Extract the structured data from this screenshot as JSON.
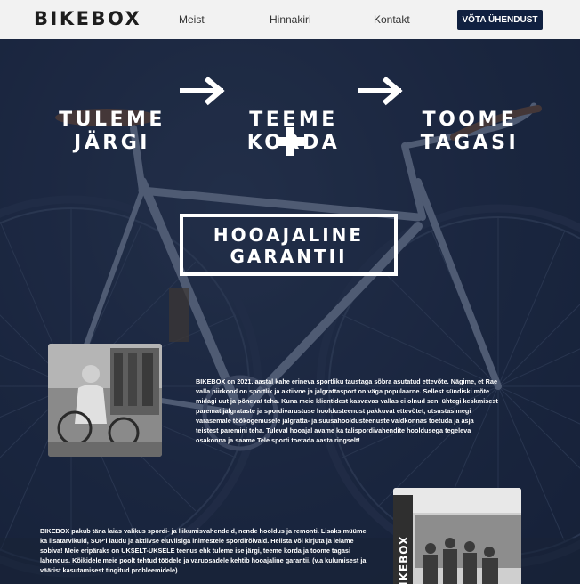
{
  "navbar": {
    "logo": "BIKEBOX",
    "links": [
      "Meist",
      "Hinnakiri",
      "Kontakt"
    ],
    "cta_label": "VÕTA ÜHENDUST"
  },
  "hero": {
    "step1": "TULEME\nJÄRGI",
    "step2": "TEEME\nKORDA",
    "step3": "TOOME\nTAGASI",
    "warranty": "HOOAJALINE\nGARANTII",
    "about_text": "BIKEBOX on 2021. aastal kahe erineva sportliku taustaga sõbra asutatud ettevõte. Nägime, et Rae valla piirkond on sportlik ja aktiivne ja jalgrattasport on väga populaarne. Sellest sündiski mõte midagi uut ja põnevat teha. Kuna meie klientidest kasvavas vallas ei olnud seni ühtegi keskmisest paremat jalgrataste ja spordivarustuse hooldusteenust pakkuvat ettevõtet, otsustasimegi varasemale töökogemusele jalgratta- ja suusahooldusteenuste valdkonnas toetuda ja asja teistest paremini teha. Tuleval hooajal avame ka talispordivahendite hooldusega tegeleva osakonna ja saame Tele sporti toetada aasta ringselt!",
    "services_text": "BIKEBOX pakub täna laias valikus spordi- ja liikumisvahendeid, nende hooldus ja remonti. Lisaks müüme ka lisatarvikuid, SUP'i laudu ja aktiivse eluviisiga inimestele spordirõivaid. Helista või kirjuta ja leiame sobiva! Meie eripäraks on UKSELT-UKSELE teenus ehk tuleme ise järgi, teeme korda ja toome tagasi lahendus. Kõikidele meie poolt tehtud töödele ja varuosadele kehtib hooajaline garantii. (v.a kulumisest ja väärist kasutamisest tingitud probleemidele)",
    "team_banner_text": "BIKEBOX"
  },
  "colors": {
    "navy": "#102040",
    "hero_bg": "#1e2a44",
    "white": "#ffffff",
    "nav_bg": "#f2f2f2"
  }
}
